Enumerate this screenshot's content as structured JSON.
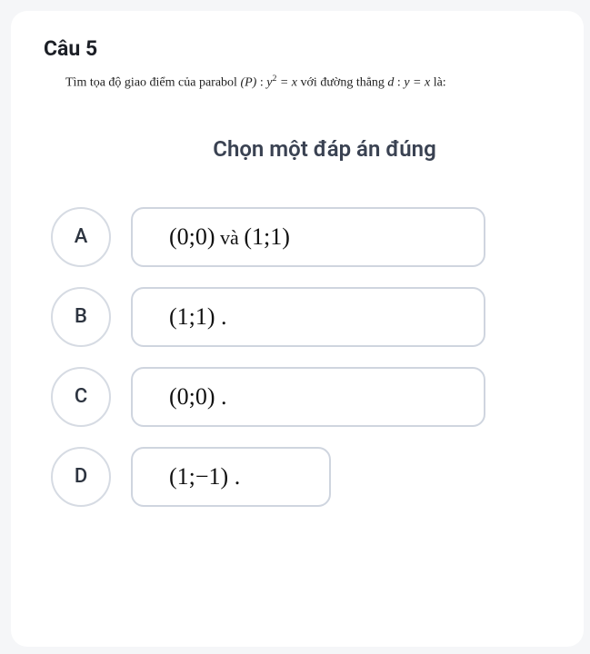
{
  "question": {
    "number": "Câu 5",
    "prefix": "Tìm tọa độ giao điểm của parabol ",
    "p_label": "(P)",
    "colon1": ": ",
    "eq1_lhs": "y",
    "eq1_exp": "2",
    "eq1_rhs": " = x",
    "mid": " với đường thẳng ",
    "d_label": "d",
    "colon2": " : ",
    "eq2": "y = x",
    "tail": " là:"
  },
  "instruction": "Chọn một đáp án đúng",
  "options": {
    "A": {
      "letter": "A",
      "math": "(0;0) và (1;1)"
    },
    "B": {
      "letter": "B",
      "math": "(1;1) ."
    },
    "C": {
      "letter": "C",
      "math": "(0;0) ."
    },
    "D": {
      "letter": "D",
      "math": "(1;−1) ."
    }
  }
}
